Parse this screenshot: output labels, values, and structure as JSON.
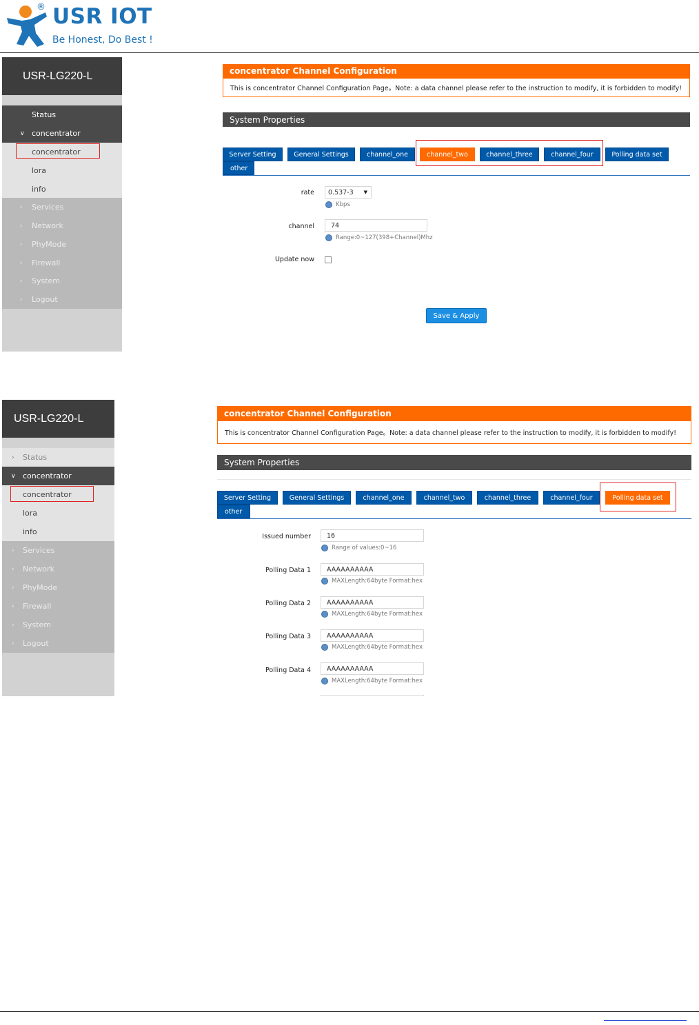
{
  "header": {
    "brand": "USR IOT",
    "registered": "®",
    "tagline": "Be Honest, Do Best !"
  },
  "screen1": {
    "device_title": "USR-LG220-L",
    "sidebar": {
      "status": "Status",
      "concentrator_group": "concentrator",
      "concentrator_item": "concentrator",
      "lora": "lora",
      "info": "info",
      "services": "Services",
      "network": "Network",
      "phymode": "PhyMode",
      "firewall": "Firewall",
      "system": "System",
      "logout": "Logout"
    },
    "page_title": "concentrator Channel Configuration",
    "note": "This is concentrator Channel Configuration Page。Note: a data channel please refer to the instruction to modify, it is forbidden to modify!",
    "section_title": "System Properties",
    "tabs": [
      "Server Setting",
      "General Settings",
      "channel_one",
      "channel_two",
      "channel_three",
      "channel_four",
      "Polling data set",
      "other"
    ],
    "active_tab": "channel_two",
    "form": {
      "rate_label": "rate",
      "rate_value": "0.537-3",
      "rate_hint": "Kbps",
      "channel_label": "channel",
      "channel_value": "74",
      "channel_hint": "Range:0~127(398+Channel)Mhz",
      "update_label": "Update now",
      "save_label": "Save & Apply"
    }
  },
  "screen2": {
    "device_title": "USR-LG220-L",
    "sidebar": {
      "status": "Status",
      "concentrator_group": "concentrator",
      "concentrator_item": "concentrator",
      "lora": "lora",
      "info": "info",
      "services": "Services",
      "network": "Network",
      "phymode": "PhyMode",
      "firewall": "Firewall",
      "system": "System",
      "logout": "Logout"
    },
    "page_title": "concentrator Channel Configuration",
    "note": "This is concentrator Channel Configuration Page。Note: a data channel please refer to the instruction to modify, it is forbidden to modify!",
    "section_title": "System Properties",
    "tabs": [
      "Server Setting",
      "General Settings",
      "channel_one",
      "channel_two",
      "channel_three",
      "channel_four",
      "Polling data set",
      "other"
    ],
    "active_tab": "Polling data set",
    "form": {
      "issued_label": "Issued number",
      "issued_value": "16",
      "issued_hint": "Range of values:0~16",
      "polling": [
        {
          "label": "Polling Data 1",
          "value": "AAAAAAAAAA",
          "hint": "MAXLength:64byte Format:hex"
        },
        {
          "label": "Polling Data 2",
          "value": "AAAAAAAAAA",
          "hint": "MAXLength:64byte Format:hex"
        },
        {
          "label": "Polling Data 3",
          "value": "AAAAAAAAAA",
          "hint": "MAXLength:64byte Format:hex"
        },
        {
          "label": "Polling Data 4",
          "value": "AAAAAAAAAA",
          "hint": "MAXLength:64byte Format:hex"
        }
      ]
    }
  },
  "colors": {
    "brand_blue": "#1f73b7",
    "orange": "#ff6a00",
    "tab_blue": "#0059a9",
    "sidebar_dark": "#3d3d3d",
    "save_blue": "#1c8fe3"
  }
}
